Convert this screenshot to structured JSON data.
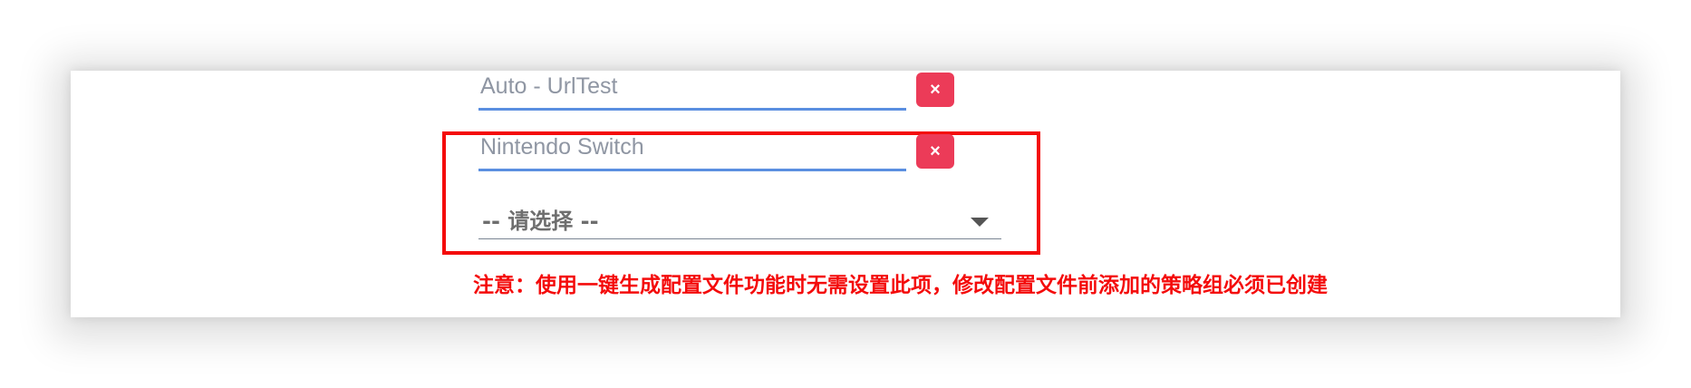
{
  "groups": [
    {
      "name_value": "Auto - UrlTest",
      "delete_label": "×"
    },
    {
      "name_value": "Nintendo Switch",
      "delete_label": "×",
      "select_value": "-- 请选择 --"
    }
  ],
  "notice": "注意：使用一键生成配置文件功能时无需设置此项，修改配置文件前添加的策略组必须已创建",
  "colors": {
    "accent_underline": "#5b8fe0",
    "delete_button": "#ec3b58",
    "highlight": "#f40b0b"
  },
  "icons": {
    "delete": "close-icon",
    "select": "chevron-down-icon"
  }
}
